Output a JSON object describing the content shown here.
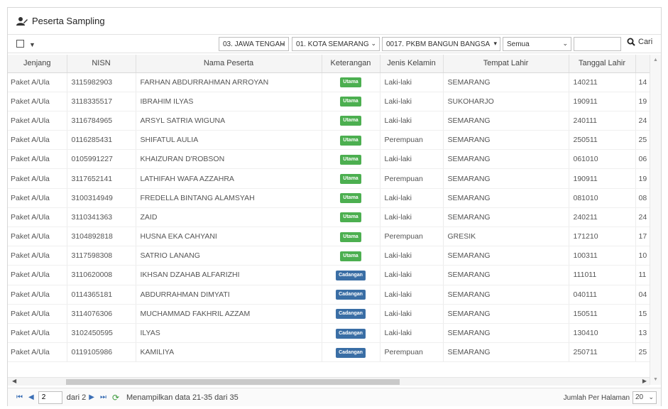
{
  "panel": {
    "title": "Peserta Sampling"
  },
  "filters": {
    "provinsi": "03. JAWA TENGAH",
    "kota": "01. KOTA SEMARANG",
    "lembaga": "0017. PKBM BANGUN BANGSA",
    "status": "Semua",
    "search_value": "",
    "search_label": "Cari"
  },
  "table": {
    "columns": [
      "Jenjang",
      "NISN",
      "Nama Peserta",
      "Keterangan",
      "Jenis Kelamin",
      "Tempat Lahir",
      "Tanggal Lahir",
      ""
    ],
    "rows": [
      [
        "Paket A/Ula",
        "3115982903",
        "FARHAN ABDURRAHMAN ARROYAN",
        "Utama",
        "Laki-laki",
        "SEMARANG",
        "140211",
        "14"
      ],
      [
        "Paket A/Ula",
        "3118335517",
        "IBRAHIM ILYAS",
        "Utama",
        "Laki-laki",
        "SUKOHARJO",
        "190911",
        "19"
      ],
      [
        "Paket A/Ula",
        "3116784965",
        "ARSYL SATRIA WIGUNA",
        "Utama",
        "Laki-laki",
        "SEMARANG",
        "240111",
        "24"
      ],
      [
        "Paket A/Ula",
        "0116285431",
        "SHIFATUL AULIA",
        "Utama",
        "Perempuan",
        "SEMARANG",
        "250511",
        "25"
      ],
      [
        "Paket A/Ula",
        "0105991227",
        "KHAIZURAN D'ROBSON",
        "Utama",
        "Laki-laki",
        "SEMARANG",
        "061010",
        "06"
      ],
      [
        "Paket A/Ula",
        "3117652141",
        "LATHIFAH WAFA AZZAHRA",
        "Utama",
        "Perempuan",
        "SEMARANG",
        "190911",
        "19"
      ],
      [
        "Paket A/Ula",
        "3100314949",
        "FREDELLA BINTANG ALAMSYAH",
        "Utama",
        "Laki-laki",
        "SEMARANG",
        "081010",
        "08"
      ],
      [
        "Paket A/Ula",
        "3110341363",
        "ZAID",
        "Utama",
        "Laki-laki",
        "SEMARANG",
        "240211",
        "24"
      ],
      [
        "Paket A/Ula",
        "3104892818",
        "HUSNA EKA CAHYANI",
        "Utama",
        "Perempuan",
        "GRESIK",
        "171210",
        "17"
      ],
      [
        "Paket A/Ula",
        "3117598308",
        "SATRIO LANANG",
        "Utama",
        "Laki-laki",
        "SEMARANG",
        "100311",
        "10"
      ],
      [
        "Paket A/Ula",
        "3110620008",
        "IKHSAN DZAHAB ALFARIZHI",
        "Cadangan",
        "Laki-laki",
        "SEMARANG",
        "111011",
        "11"
      ],
      [
        "Paket A/Ula",
        "0114365181",
        "ABDURRAHMAN DIMYATI",
        "Cadangan",
        "Laki-laki",
        "SEMARANG",
        "040111",
        "04"
      ],
      [
        "Paket A/Ula",
        "3114076306",
        "MUCHAMMAD FAKHRIL AZZAM",
        "Cadangan",
        "Laki-laki",
        "SEMARANG",
        "150511",
        "15"
      ],
      [
        "Paket A/Ula",
        "3102450595",
        "ILYAS",
        "Cadangan",
        "Laki-laki",
        "SEMARANG",
        "130410",
        "13"
      ],
      [
        "Paket A/Ula",
        "0119105986",
        "KAMILIYA",
        "Cadangan",
        "Perempuan",
        "SEMARANG",
        "250711",
        "25"
      ]
    ]
  },
  "colors": {
    "utama": "#4caf50",
    "cadangan": "#3a6ea5"
  },
  "pager": {
    "page": "2",
    "of_pages": "dari 2",
    "info": "Menampilkan data 21-35 dari 35",
    "per_page_label": "Jumlah Per Halaman",
    "per_page": "20"
  }
}
